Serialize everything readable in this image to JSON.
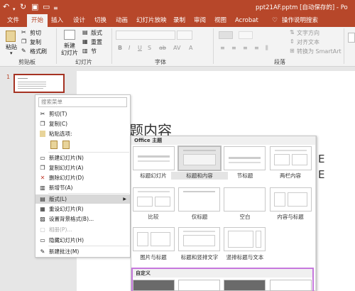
{
  "titlebar": {
    "quick_access_icons": [
      "undo-icon",
      "redo-icon",
      "save-icon",
      "slideshow-icon",
      "customize-icon"
    ],
    "doc_title": "ppt21AF.pptm [自动保存的] - Po"
  },
  "tabs": [
    "文件",
    "开始",
    "插入",
    "设计",
    "切换",
    "动画",
    "幻灯片放映",
    "录制",
    "审阅",
    "视图",
    "Acrobat",
    "操作说明搜索"
  ],
  "active_tab": "开始",
  "ribbon": {
    "clipboard": {
      "paste": "粘贴",
      "cut": "剪切",
      "copy": "复制",
      "format_painter": "格式刷",
      "group": "剪贴板"
    },
    "slides": {
      "new_slide": "新建",
      "new_slide_2": "幻灯片",
      "layout": "版式",
      "reset": "重置",
      "section": "节",
      "group": "幻灯片"
    },
    "font": {
      "group": "字体"
    },
    "paragraph": {
      "text_direction": "文字方向",
      "align_text": "对齐文本",
      "smartart": "转换为 SmartArt",
      "group": "段落"
    }
  },
  "slide_panel": {
    "slide_number": "1"
  },
  "slide": {
    "title_fragment": "题内容",
    "right_mark_1": "E",
    "right_mark_2": "E"
  },
  "context_menu": {
    "search_placeholder": "搜索菜单",
    "items": [
      {
        "label": "剪切(T)",
        "icon": "scissors-icon",
        "enabled": true
      },
      {
        "label": "复制(C)",
        "icon": "copy-icon",
        "enabled": true
      },
      {
        "label": "粘贴选项:",
        "icon": "paste-icon",
        "enabled": true
      },
      {
        "label": "新建幻灯片(N)",
        "icon": "new-slide-icon",
        "enabled": true
      },
      {
        "label": "复制幻灯片(A)",
        "icon": "duplicate-slide-icon",
        "enabled": true
      },
      {
        "label": "删除幻灯片(D)",
        "icon": "delete-slide-icon",
        "enabled": true
      },
      {
        "label": "新增节(A)",
        "icon": "section-icon",
        "enabled": true
      },
      {
        "label": "版式(L)",
        "icon": "layout-icon",
        "enabled": true,
        "highlighted": true
      },
      {
        "label": "重设幻灯片(R)",
        "icon": "reset-icon",
        "enabled": true
      },
      {
        "label": "设置背景格式(B)...",
        "icon": "background-icon",
        "enabled": true
      },
      {
        "label": "相册(P)...",
        "icon": "album-icon",
        "enabled": false
      },
      {
        "label": "隐藏幻灯片(H)",
        "icon": "hide-slide-icon",
        "enabled": true
      },
      {
        "label": "新建批注(M)",
        "icon": "comment-icon",
        "enabled": true
      }
    ]
  },
  "layout_menu": {
    "office_theme_header": "Office 主题",
    "custom_header": "自定义",
    "layouts": [
      "标题幻灯片",
      "标题和内容",
      "节标题",
      "两栏内容",
      "比较",
      "仅标题",
      "空白",
      "内容与标题",
      "图片与标题",
      "标题和竖排文字",
      "竖排标题与文本"
    ],
    "selected": "标题和内容"
  }
}
